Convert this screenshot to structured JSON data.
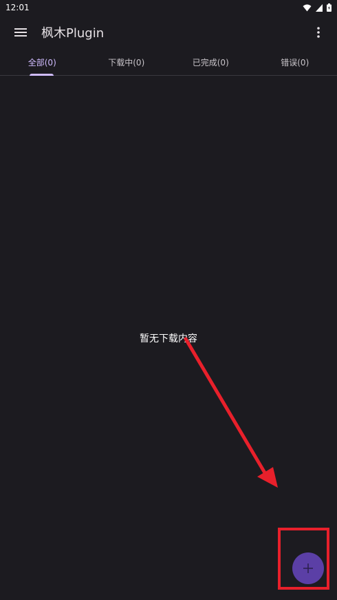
{
  "status_bar": {
    "time": "12:01"
  },
  "app_bar": {
    "title": "枫木Plugin"
  },
  "tabs": [
    {
      "label": "全部(0)",
      "active": true
    },
    {
      "label": "下载中(0)",
      "active": false
    },
    {
      "label": "已完成(0)",
      "active": false
    },
    {
      "label": "错误(0)",
      "active": false
    }
  ],
  "main": {
    "empty_message": "暂无下载内容"
  },
  "colors": {
    "accent": "#d0bcff",
    "fab": "#5b3fa6",
    "annotation": "#e8202b",
    "background": "#1c1b20"
  }
}
